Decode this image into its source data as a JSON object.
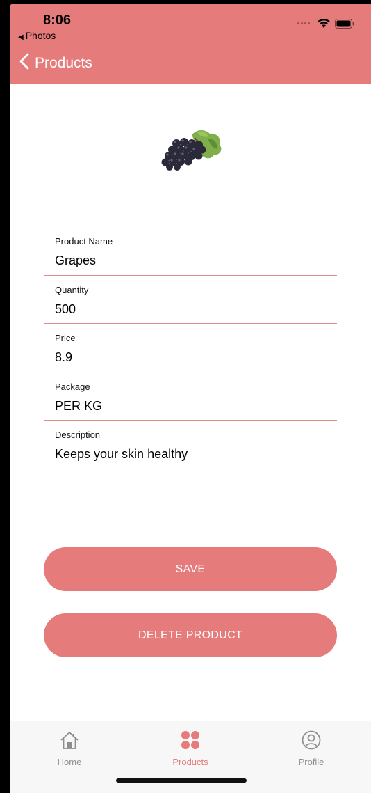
{
  "status_bar": {
    "time": "8:06",
    "back_app": "Photos"
  },
  "nav": {
    "back_label": "Products"
  },
  "product": {
    "image_icon": "grapes-image"
  },
  "form": {
    "fields": [
      {
        "label": "Product Name",
        "value": "Grapes"
      },
      {
        "label": "Quantity",
        "value": "500"
      },
      {
        "label": "Price",
        "value": "8.9"
      },
      {
        "label": "Package",
        "value": "PER KG"
      },
      {
        "label": "Description",
        "value": "Keeps your skin healthy"
      }
    ]
  },
  "buttons": {
    "save_label": "SAVE",
    "delete_label": "DELETE PRODUCT"
  },
  "tabbar": {
    "tabs": [
      {
        "label": "Home",
        "icon": "home-icon",
        "active": false
      },
      {
        "label": "Products",
        "icon": "products-grid-icon",
        "active": true
      },
      {
        "label": "Profile",
        "icon": "profile-icon",
        "active": false
      }
    ]
  },
  "colors": {
    "accent": "#e57b7a",
    "inactive_tab": "#8e8e8e"
  }
}
